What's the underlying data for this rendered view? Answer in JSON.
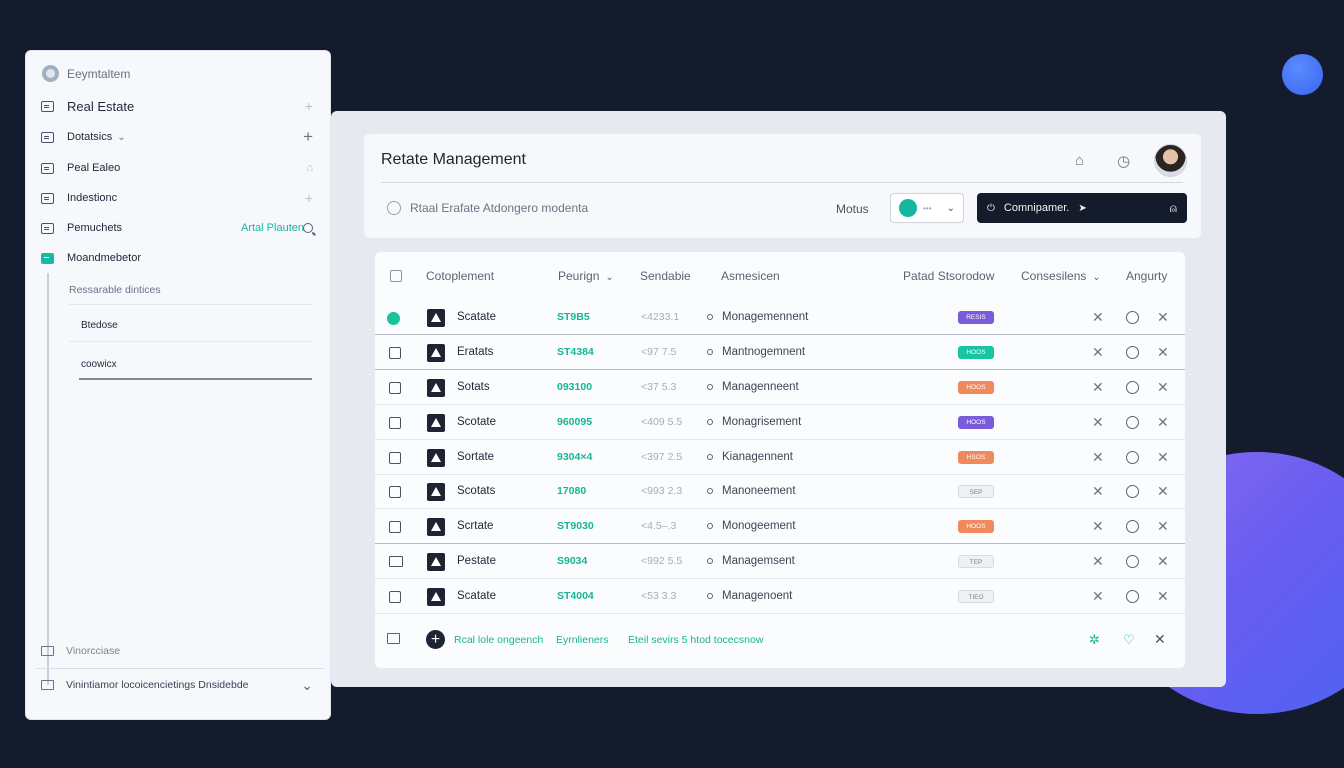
{
  "sidebar": {
    "brand": "Eeymtaltem",
    "items": [
      {
        "label": "Real Estate",
        "icon": "list-icon",
        "right": "+"
      },
      {
        "label": "Dotatsics",
        "icon": "grid-icon",
        "right": "+"
      },
      {
        "label": "Peal Ealeo",
        "icon": "card-icon",
        "right": "lock"
      },
      {
        "label": "Indestionc",
        "icon": "list-icon",
        "right": "+"
      },
      {
        "label": "Pemuchets",
        "icon": "grid-icon",
        "accent": "Artal Plauten",
        "right": "search"
      },
      {
        "label": "Moandmebetor",
        "icon": "folder-icon",
        "active": true
      }
    ],
    "sub_heading": "Ressarable dintices",
    "sub_items": [
      "Btedose",
      "coowicx"
    ],
    "footer_item": "Vinorcciase",
    "footer_dropdown": "Vinintiamor locoicencietings Dnsidebde"
  },
  "header": {
    "title": "Retate Management",
    "search_text": "Rtaal Erafate Atdongero modenta",
    "modus_label": "Motus",
    "toggle_dots": "•••",
    "command_label": "Comnipamer."
  },
  "table": {
    "columns": [
      "Cotoplement",
      "Peurign",
      "Sendabie",
      "Asmesicen",
      "Patad Stsorodow",
      "Consesilens",
      "Angurty"
    ],
    "rows": [
      {
        "marker": "green",
        "name": "Scatate",
        "num": "ST9B5",
        "ver": "<4233.1",
        "mgmt": "Monagemennent",
        "badge": "purple",
        "badge_text": "RESIS"
      },
      {
        "marker": "box",
        "name": "Eratats",
        "num": "ST4384",
        "ver": "<97 7.5",
        "mgmt": "Mantnogemnent",
        "badge": "teal",
        "badge_text": "HOOS"
      },
      {
        "marker": "box",
        "name": "Sotats",
        "num": "093100",
        "ver": "<37 5.3",
        "mgmt": "Managenneent",
        "badge": "orange",
        "badge_text": "HOOS"
      },
      {
        "marker": "box",
        "name": "Scotate",
        "num": "960095",
        "ver": "<409 5.5",
        "mgmt": "Monagrisement",
        "badge": "purple",
        "badge_text": "HOOS"
      },
      {
        "marker": "box",
        "name": "Sortate",
        "num": "9304×4",
        "ver": "<397 2.5",
        "mgmt": "Kianagennent",
        "badge": "orange",
        "badge_text": "HSOS"
      },
      {
        "marker": "box",
        "name": "Scotats",
        "num": "17080",
        "ver": "<993 2.3",
        "mgmt": "Manoneement",
        "badge": "light",
        "badge_text": "SEP"
      },
      {
        "marker": "box",
        "name": "Scrtate",
        "num": "ST9030",
        "ver": "<4.5–.3",
        "mgmt": "Monogeement",
        "badge": "orange",
        "badge_text": "HOOS"
      },
      {
        "marker": "img",
        "name": "Pestate",
        "num": "S9034",
        "ver": "<992 5.5",
        "mgmt": "Managemsent",
        "badge": "light",
        "badge_text": "TEP"
      },
      {
        "marker": "box",
        "name": "Scatate",
        "num": "ST4004",
        "ver": "<53 3.3",
        "mgmt": "Managenoent",
        "badge": "light",
        "badge_text": "TIEO"
      }
    ],
    "footer": {
      "t1": "Rcal lole ongeench",
      "t2": "Eyrnlieners",
      "t3": "Eteil sevirs 5 htod tocecsnow"
    }
  },
  "colors": {
    "accent": "#19b8a6",
    "background": "#141b2d",
    "badge_purple": "#7a5bd9",
    "badge_teal": "#18c4a3",
    "badge_orange": "#f08a5d"
  }
}
